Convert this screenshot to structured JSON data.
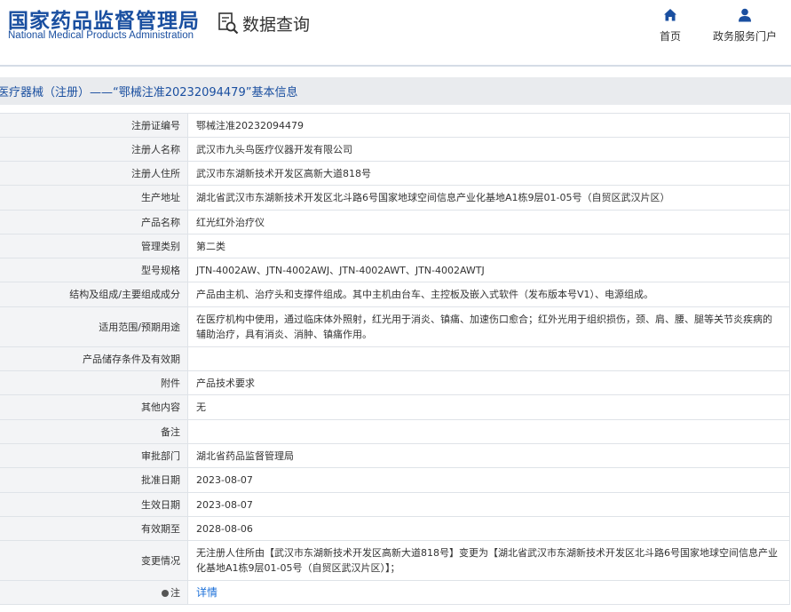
{
  "header": {
    "logo_cn": "国家药品监督管理局",
    "logo_en": "National Medical Products Administration",
    "query_label": "数据查询",
    "nav": [
      {
        "label": "首页",
        "icon": "home-icon"
      },
      {
        "label": "政务服务门户",
        "icon": "user-icon"
      }
    ],
    "accent_color": "#1a4fa0"
  },
  "title_bar": {
    "text": "医疗器械（注册）——“鄂械注准20232094479”基本信息"
  },
  "rows": [
    {
      "key": "注册证编号",
      "value": "鄂械注准20232094479",
      "h": 27
    },
    {
      "key": "注册人名称",
      "value": "武汉市九头鸟医疗仪器开发有限公司",
      "h": 27
    },
    {
      "key": "注册人住所",
      "value": "武汉市东湖新技术开发区高新大道818号",
      "h": 27
    },
    {
      "key": "生产地址",
      "value": "湖北省武汉市东湖新技术开发区北斗路6号国家地球空间信息产业化基地A1栋9层01-05号（自贸区武汉片区）",
      "h": 28
    },
    {
      "key": "产品名称",
      "value": "红光红外治疗仪",
      "h": 27
    },
    {
      "key": "管理类别",
      "value": "第二类",
      "h": 27
    },
    {
      "key": "型号规格",
      "value": "JTN-4002AW、JTN-4002AWJ、JTN-4002AWT、JTN-4002AWTJ",
      "h": 27
    },
    {
      "key": "结构及组成/主要组成成分",
      "value": "产品由主机、治疗头和支撑件组成。其中主机由台车、主控板及嵌入式软件（发布版本号V1）、电源组成。",
      "h": 28
    },
    {
      "key": "适用范围/预期用途",
      "value": "在医疗机构中使用，通过临床体外照射，红光用于消炎、镇痛、加速伤口愈合；红外光用于组织损伤，颈、肩、腰、腿等关节炎疾病的辅助治疗，具有消炎、消肿、镇痛作用。",
      "h": 45
    },
    {
      "key": "产品储存条件及有效期",
      "value": "",
      "h": 27
    },
    {
      "key": "附件",
      "value": "产品技术要求",
      "h": 27
    },
    {
      "key": "其他内容",
      "value": "无",
      "h": 28
    },
    {
      "key": "备注",
      "value": "",
      "h": 27
    },
    {
      "key": "审批部门",
      "value": "湖北省药品监督管理局",
      "h": 27
    },
    {
      "key": "批准日期",
      "value": "2023-08-07",
      "h": 28
    },
    {
      "key": "生效日期",
      "value": "2023-08-07",
      "h": 27
    },
    {
      "key": "有效期至",
      "value": "2028-08-06",
      "h": 27
    },
    {
      "key": "变更情况",
      "value": "无注册人住所由【武汉市东湖新技术开发区高新大道818号】变更为【湖北省武汉市东湖新技术开发区北斗路6号国家地球空间信息产业化基地A1栋9层01-05号（自贸区武汉片区）】；",
      "h": 45
    }
  ],
  "note_row": {
    "key": "注",
    "link": "详情",
    "h": 27
  }
}
